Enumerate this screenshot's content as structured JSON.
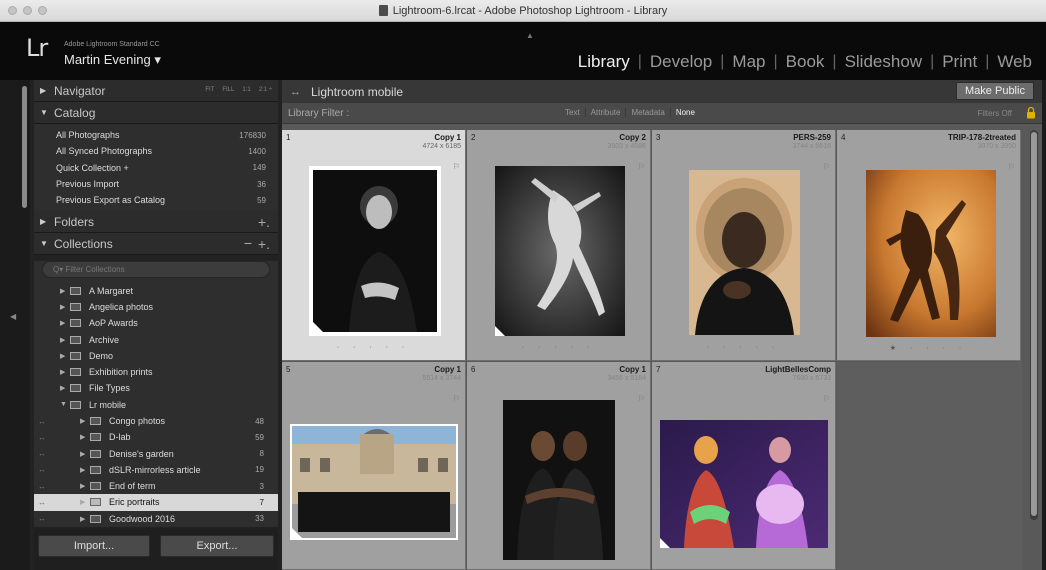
{
  "window": {
    "title": "Lightroom-6.lrcat - Adobe Photoshop Lightroom - Library"
  },
  "identity": {
    "logo": "Lr",
    "product": "Adobe Lightroom Standard CC",
    "user": "Martin Evening ▾"
  },
  "modules": [
    "Library",
    "Develop",
    "Map",
    "Book",
    "Slideshow",
    "Print",
    "Web"
  ],
  "active_module": "Library",
  "navigator": {
    "label": "Navigator",
    "zoom": [
      "FIT",
      "FILL",
      "1:1",
      "2:1 ÷"
    ]
  },
  "catalog": {
    "label": "Catalog",
    "items": [
      {
        "label": "All Photographs",
        "count": "176830"
      },
      {
        "label": "All Synced Photographs",
        "count": "1400"
      },
      {
        "label": "Quick Collection +",
        "count": "149"
      },
      {
        "label": "Previous Import",
        "count": "36"
      },
      {
        "label": "Previous Export as Catalog",
        "count": "59"
      }
    ]
  },
  "folders": {
    "label": "Folders",
    "plus": "+."
  },
  "collections": {
    "label": "Collections",
    "minus": "−",
    "plus": "+.",
    "filter_placeholder": "Q▾ Filter Collections",
    "items": [
      {
        "label": "A Margaret",
        "count": "",
        "level": 1
      },
      {
        "label": "Angelica photos",
        "count": "",
        "level": 1
      },
      {
        "label": "AoP Awards",
        "count": "",
        "level": 1
      },
      {
        "label": "Archive",
        "count": "",
        "level": 1
      },
      {
        "label": "Demo",
        "count": "",
        "level": 1
      },
      {
        "label": "Exhibition prints",
        "count": "",
        "level": 1
      },
      {
        "label": "File Types",
        "count": "",
        "level": 1
      },
      {
        "label": "Lr mobile",
        "count": "",
        "level": 1
      },
      {
        "label": "Congo photos",
        "count": "48",
        "level": 2
      },
      {
        "label": "D-lab",
        "count": "59",
        "level": 2
      },
      {
        "label": "Denise's garden",
        "count": "8",
        "level": 2
      },
      {
        "label": "dSLR-mirrorless article",
        "count": "19",
        "level": 2
      },
      {
        "label": "End of term",
        "count": "3",
        "level": 2
      },
      {
        "label": "Eric portraits",
        "count": "7",
        "level": 2,
        "selected": true
      },
      {
        "label": "Goodwood 2016",
        "count": "33",
        "level": 2
      }
    ]
  },
  "buttons": {
    "import": "Import...",
    "export": "Export..."
  },
  "collection_bar": {
    "title": "Lightroom mobile",
    "make_public": "Make Public"
  },
  "filter_bar": {
    "label": "Library Filter :",
    "options": [
      "Text",
      "Attribute",
      "Metadata",
      "None"
    ],
    "active": "None",
    "filters_off": "Filters Off"
  },
  "photos": [
    {
      "index": "1",
      "name": "Copy 1",
      "dims": "4724 x 6185",
      "rating": "· · · · ·",
      "selected": true
    },
    {
      "index": "2",
      "name": "Copy 2",
      "dims": "3503 x 4586",
      "rating": "· · · · ·"
    },
    {
      "index": "3",
      "name": "PERS-259",
      "dims": "3744 x 5616",
      "rating": "· · · · ·"
    },
    {
      "index": "4",
      "name": "TRIP-178-2treated",
      "dims": "3070 x 3950",
      "rating": "★ · · · ·"
    },
    {
      "index": "5",
      "name": "Copy 1",
      "dims": "5514 x 3744",
      "rating": ""
    },
    {
      "index": "6",
      "name": "Copy 1",
      "dims": "3456 x 5184",
      "rating": ""
    },
    {
      "index": "7",
      "name": "LightBellesComp",
      "dims": "7680 x 5733",
      "rating": ""
    }
  ],
  "colors": {
    "selected_row": "#d8d8d8",
    "lock": "#e0b100"
  }
}
